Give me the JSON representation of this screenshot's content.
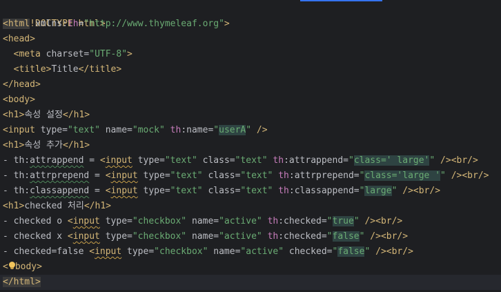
{
  "editor": {
    "accent_color": "#3574f0",
    "lines": [
      {
        "text": "<!DOCTYPE html>"
      },
      {
        "text": "<html xmlns:th=\"http://www.thymeleaf.org\">"
      },
      {
        "text": "<head>"
      },
      {
        "text": "  <meta charset=\"UTF-8\">"
      },
      {
        "text": "  <title>Title</title>"
      },
      {
        "text": "</head>"
      },
      {
        "text": "<body>"
      },
      {
        "text": "<h1>속성 설정</h1>"
      },
      {
        "text": "<input type=\"text\" name=\"mock\" th:name=\"userA\" />"
      },
      {
        "text": "<h1>속성 추가</h1>"
      },
      {
        "text": "- th:attrappend = <input type=\"text\" class=\"text\" th:attrappend=\"class=' large'\" /><br/>"
      },
      {
        "text": "- th:attrprepend = <input type=\"text\" class=\"text\" th:attrprepend=\"class='large '\" /><br/>"
      },
      {
        "text": "- th:classappend = <input type=\"text\" class=\"text\" th:classappend=\"large\" /><br/>"
      },
      {
        "text": "<h1>checked 처리</h1>"
      },
      {
        "text": "- checked o <input type=\"checkbox\" name=\"active\" th:checked=\"true\" /><br/>"
      },
      {
        "text": "- checked x <input type=\"checkbox\" name=\"active\" th:checked=\"false\" /><br/>"
      },
      {
        "text": "- checked=false <input type=\"checkbox\" name=\"active\" checked=\"false\" /><br/>"
      },
      {
        "text": "</body>"
      },
      {
        "text": "</html>"
      }
    ]
  }
}
